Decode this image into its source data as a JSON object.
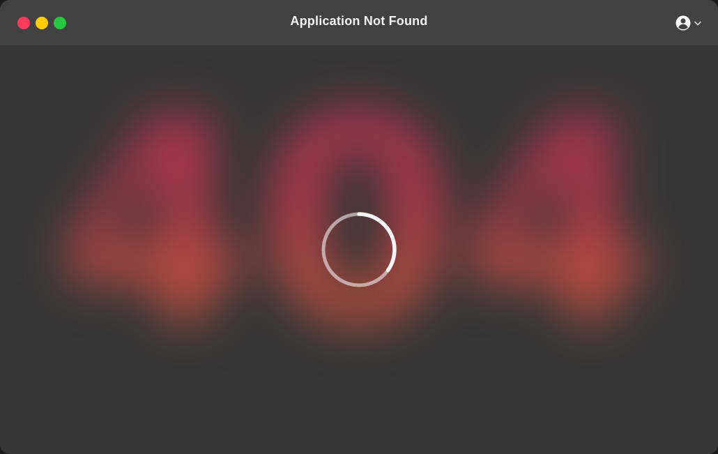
{
  "window": {
    "title": "Application Not Found"
  },
  "traffic_lights": {
    "close_color": "#ff3b5c",
    "minimize_color": "#ffcc00",
    "maximize_color": "#28c840"
  },
  "account_menu": {
    "icon": "user-circle-icon",
    "chevron": "chevron-down-icon"
  },
  "background": {
    "blurred_text": "404",
    "accent_color": "#d0305a"
  },
  "loader": {
    "icon": "loading-spinner-icon"
  }
}
